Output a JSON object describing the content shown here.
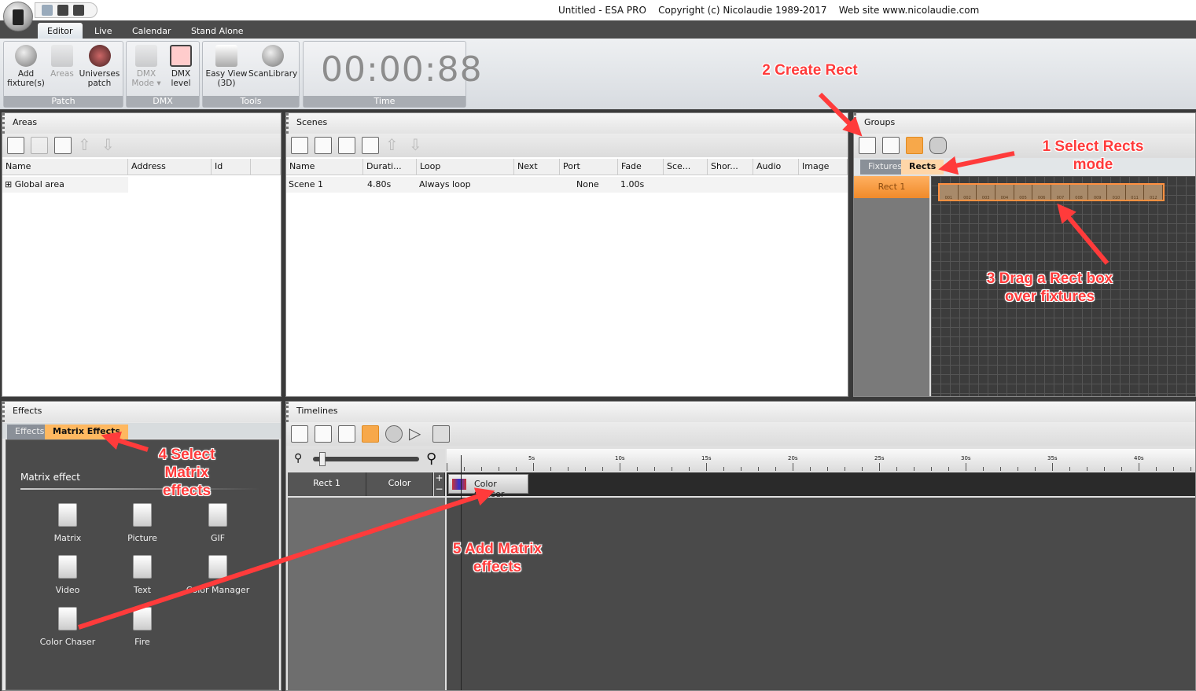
{
  "window": {
    "title": "Untitled - ESA PRO    Copyright (c) Nicolaudie 1989-2017    Web site www.nicolaudie.com"
  },
  "ribbon": {
    "tabs": [
      {
        "label": "Editor",
        "active": true
      },
      {
        "label": "Live"
      },
      {
        "label": "Calendar"
      },
      {
        "label": "Stand Alone"
      }
    ],
    "groups": {
      "patch": "Patch",
      "dmx": "DMX",
      "tools": "Tools",
      "time": "Time"
    },
    "buttons": {
      "add_fixture": "Add fixture(s)",
      "areas": "Areas",
      "universes": "Universes patch",
      "dmx_mode": "DMX Mode ▾",
      "dmx_level": "DMX level",
      "easy_view": "Easy View (3D)",
      "scanlibrary": "ScanLibrary"
    },
    "time": "00:00:88"
  },
  "areas": {
    "title": "Areas",
    "columns": [
      "Name",
      "Address",
      "Id"
    ],
    "rows": [
      {
        "name": "Global area"
      }
    ]
  },
  "scenes": {
    "title": "Scenes",
    "columns": [
      "Name",
      "Durati...",
      "Loop",
      "Next",
      "Port",
      "Fade",
      "Sce...",
      "Shor...",
      "Audio",
      "Image"
    ],
    "rows": [
      {
        "name": "Scene 1",
        "duration": "4.80s",
        "loop": "Always loop",
        "port": "None",
        "fade": "1.00s"
      }
    ]
  },
  "groups": {
    "title": "Groups",
    "tabs": [
      "Fixtures",
      "Rects"
    ],
    "active_tab": "Rects",
    "rects": [
      "Rect 1"
    ],
    "fixtures": [
      "001",
      "002",
      "003",
      "004",
      "005",
      "006",
      "007",
      "008",
      "009",
      "010",
      "011",
      "012"
    ]
  },
  "effects": {
    "title": "Effects",
    "tabs": [
      "Effects",
      "Matrix Effects"
    ],
    "active_tab": "Matrix Effects",
    "section": "Matrix effect",
    "items": [
      "Matrix",
      "Picture",
      "GIF",
      "Video",
      "Text",
      "Color Manager",
      "Color Chaser",
      "Fire"
    ]
  },
  "timelines": {
    "title": "Timelines",
    "ruler": [
      "5s",
      "10s",
      "15s",
      "20s",
      "25s",
      "30s",
      "35s",
      "40s"
    ],
    "track": {
      "name": "Rect 1",
      "type": "Color",
      "clip": "Color Chaser"
    }
  },
  "annotations": {
    "a1": "1 Select Rects mode",
    "a2": "2 Create Rect",
    "a3": "3 Drag a Rect box over fixtures",
    "a4": "4 Select Matrix effects",
    "a5": "5 Add Matrix effects"
  },
  "colors": {
    "accent": "#f7a84a",
    "annotation": "#ff3b3b"
  }
}
